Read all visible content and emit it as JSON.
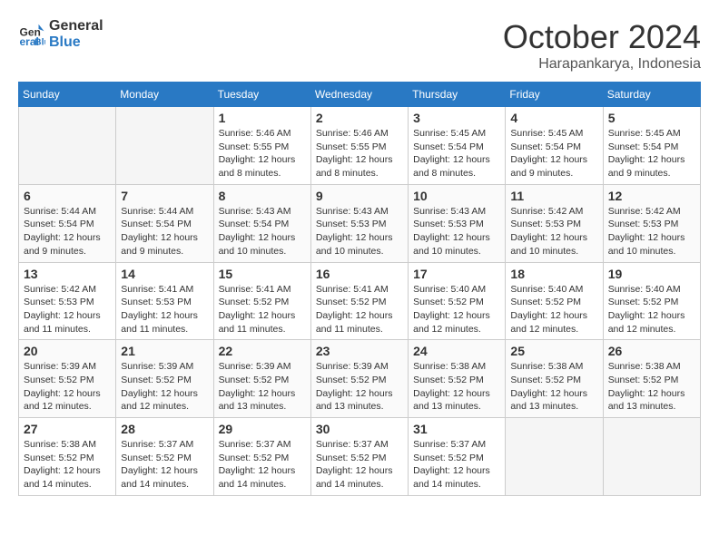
{
  "header": {
    "logo_line1": "General",
    "logo_line2": "Blue",
    "month": "October 2024",
    "location": "Harapankarya, Indonesia"
  },
  "weekdays": [
    "Sunday",
    "Monday",
    "Tuesday",
    "Wednesday",
    "Thursday",
    "Friday",
    "Saturday"
  ],
  "weeks": [
    [
      {
        "day": "",
        "sunrise": "",
        "sunset": "",
        "daylight": ""
      },
      {
        "day": "",
        "sunrise": "",
        "sunset": "",
        "daylight": ""
      },
      {
        "day": "1",
        "sunrise": "Sunrise: 5:46 AM",
        "sunset": "Sunset: 5:55 PM",
        "daylight": "Daylight: 12 hours and 8 minutes."
      },
      {
        "day": "2",
        "sunrise": "Sunrise: 5:46 AM",
        "sunset": "Sunset: 5:55 PM",
        "daylight": "Daylight: 12 hours and 8 minutes."
      },
      {
        "day": "3",
        "sunrise": "Sunrise: 5:45 AM",
        "sunset": "Sunset: 5:54 PM",
        "daylight": "Daylight: 12 hours and 8 minutes."
      },
      {
        "day": "4",
        "sunrise": "Sunrise: 5:45 AM",
        "sunset": "Sunset: 5:54 PM",
        "daylight": "Daylight: 12 hours and 9 minutes."
      },
      {
        "day": "5",
        "sunrise": "Sunrise: 5:45 AM",
        "sunset": "Sunset: 5:54 PM",
        "daylight": "Daylight: 12 hours and 9 minutes."
      }
    ],
    [
      {
        "day": "6",
        "sunrise": "Sunrise: 5:44 AM",
        "sunset": "Sunset: 5:54 PM",
        "daylight": "Daylight: 12 hours and 9 minutes."
      },
      {
        "day": "7",
        "sunrise": "Sunrise: 5:44 AM",
        "sunset": "Sunset: 5:54 PM",
        "daylight": "Daylight: 12 hours and 9 minutes."
      },
      {
        "day": "8",
        "sunrise": "Sunrise: 5:43 AM",
        "sunset": "Sunset: 5:54 PM",
        "daylight": "Daylight: 12 hours and 10 minutes."
      },
      {
        "day": "9",
        "sunrise": "Sunrise: 5:43 AM",
        "sunset": "Sunset: 5:53 PM",
        "daylight": "Daylight: 12 hours and 10 minutes."
      },
      {
        "day": "10",
        "sunrise": "Sunrise: 5:43 AM",
        "sunset": "Sunset: 5:53 PM",
        "daylight": "Daylight: 12 hours and 10 minutes."
      },
      {
        "day": "11",
        "sunrise": "Sunrise: 5:42 AM",
        "sunset": "Sunset: 5:53 PM",
        "daylight": "Daylight: 12 hours and 10 minutes."
      },
      {
        "day": "12",
        "sunrise": "Sunrise: 5:42 AM",
        "sunset": "Sunset: 5:53 PM",
        "daylight": "Daylight: 12 hours and 10 minutes."
      }
    ],
    [
      {
        "day": "13",
        "sunrise": "Sunrise: 5:42 AM",
        "sunset": "Sunset: 5:53 PM",
        "daylight": "Daylight: 12 hours and 11 minutes."
      },
      {
        "day": "14",
        "sunrise": "Sunrise: 5:41 AM",
        "sunset": "Sunset: 5:53 PM",
        "daylight": "Daylight: 12 hours and 11 minutes."
      },
      {
        "day": "15",
        "sunrise": "Sunrise: 5:41 AM",
        "sunset": "Sunset: 5:52 PM",
        "daylight": "Daylight: 12 hours and 11 minutes."
      },
      {
        "day": "16",
        "sunrise": "Sunrise: 5:41 AM",
        "sunset": "Sunset: 5:52 PM",
        "daylight": "Daylight: 12 hours and 11 minutes."
      },
      {
        "day": "17",
        "sunrise": "Sunrise: 5:40 AM",
        "sunset": "Sunset: 5:52 PM",
        "daylight": "Daylight: 12 hours and 12 minutes."
      },
      {
        "day": "18",
        "sunrise": "Sunrise: 5:40 AM",
        "sunset": "Sunset: 5:52 PM",
        "daylight": "Daylight: 12 hours and 12 minutes."
      },
      {
        "day": "19",
        "sunrise": "Sunrise: 5:40 AM",
        "sunset": "Sunset: 5:52 PM",
        "daylight": "Daylight: 12 hours and 12 minutes."
      }
    ],
    [
      {
        "day": "20",
        "sunrise": "Sunrise: 5:39 AM",
        "sunset": "Sunset: 5:52 PM",
        "daylight": "Daylight: 12 hours and 12 minutes."
      },
      {
        "day": "21",
        "sunrise": "Sunrise: 5:39 AM",
        "sunset": "Sunset: 5:52 PM",
        "daylight": "Daylight: 12 hours and 12 minutes."
      },
      {
        "day": "22",
        "sunrise": "Sunrise: 5:39 AM",
        "sunset": "Sunset: 5:52 PM",
        "daylight": "Daylight: 12 hours and 13 minutes."
      },
      {
        "day": "23",
        "sunrise": "Sunrise: 5:39 AM",
        "sunset": "Sunset: 5:52 PM",
        "daylight": "Daylight: 12 hours and 13 minutes."
      },
      {
        "day": "24",
        "sunrise": "Sunrise: 5:38 AM",
        "sunset": "Sunset: 5:52 PM",
        "daylight": "Daylight: 12 hours and 13 minutes."
      },
      {
        "day": "25",
        "sunrise": "Sunrise: 5:38 AM",
        "sunset": "Sunset: 5:52 PM",
        "daylight": "Daylight: 12 hours and 13 minutes."
      },
      {
        "day": "26",
        "sunrise": "Sunrise: 5:38 AM",
        "sunset": "Sunset: 5:52 PM",
        "daylight": "Daylight: 12 hours and 13 minutes."
      }
    ],
    [
      {
        "day": "27",
        "sunrise": "Sunrise: 5:38 AM",
        "sunset": "Sunset: 5:52 PM",
        "daylight": "Daylight: 12 hours and 14 minutes."
      },
      {
        "day": "28",
        "sunrise": "Sunrise: 5:37 AM",
        "sunset": "Sunset: 5:52 PM",
        "daylight": "Daylight: 12 hours and 14 minutes."
      },
      {
        "day": "29",
        "sunrise": "Sunrise: 5:37 AM",
        "sunset": "Sunset: 5:52 PM",
        "daylight": "Daylight: 12 hours and 14 minutes."
      },
      {
        "day": "30",
        "sunrise": "Sunrise: 5:37 AM",
        "sunset": "Sunset: 5:52 PM",
        "daylight": "Daylight: 12 hours and 14 minutes."
      },
      {
        "day": "31",
        "sunrise": "Sunrise: 5:37 AM",
        "sunset": "Sunset: 5:52 PM",
        "daylight": "Daylight: 12 hours and 14 minutes."
      },
      {
        "day": "",
        "sunrise": "",
        "sunset": "",
        "daylight": ""
      },
      {
        "day": "",
        "sunrise": "",
        "sunset": "",
        "daylight": ""
      }
    ]
  ]
}
